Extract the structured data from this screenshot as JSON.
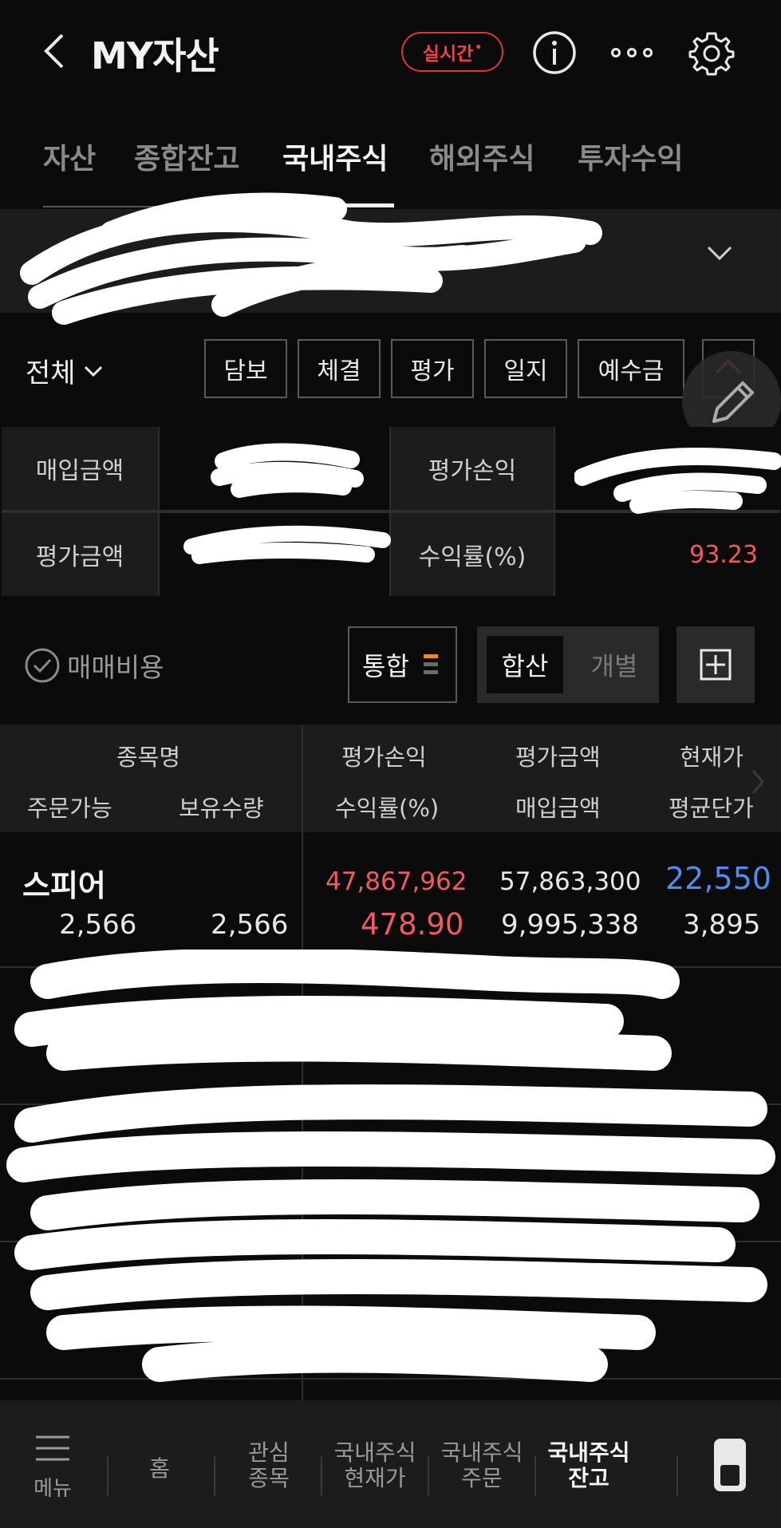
{
  "header": {
    "title": "MY자산",
    "realtime_label": "실시간",
    "realtime_dot": "•"
  },
  "tabs": [
    {
      "label": "자산",
      "active": false
    },
    {
      "label": "종합잔고",
      "active": false
    },
    {
      "label": "국내주식",
      "active": true
    },
    {
      "label": "해외주식",
      "active": false
    },
    {
      "label": "투자수익",
      "active": false
    }
  ],
  "filter": {
    "all_label": "전체",
    "buttons": [
      "담보",
      "체결",
      "평가",
      "일지",
      "예수금"
    ]
  },
  "summary": {
    "purchase_label": "매입금액",
    "eval_pnl_label": "평가손익",
    "eval_amount_label": "평가금액",
    "return_label": "수익률(%)",
    "return_value": "93.23"
  },
  "options": {
    "fee_label": "매매비용",
    "tonghap_label": "통합",
    "seg_on": "합산",
    "seg_off": "개별"
  },
  "table": {
    "headers_top": [
      "종목명",
      "평가손익",
      "평가금액",
      "현재가"
    ],
    "headers_bottom": [
      "주문가능",
      "보유수량",
      "수익률(%)",
      "매입금액",
      "평균단가"
    ],
    "rows": [
      {
        "name": "스피어",
        "order_avail": "2,566",
        "holding_qty": "2,566",
        "eval_pnl": "47,867,962",
        "return_rate": "478.90",
        "eval_amount": "57,863,300",
        "purchase_amount": "9,995,338",
        "current_price": "22,550",
        "avg_price": "3,895"
      }
    ]
  },
  "bottom_nav": {
    "menu_label": "메뉴",
    "items": [
      {
        "label": "홈",
        "active": false
      },
      {
        "label": "관심\n종목",
        "active": false
      },
      {
        "label": "국내주식\n현재가",
        "active": false
      },
      {
        "label": "국내주식\n주문",
        "active": false
      },
      {
        "label": "국내주식\n잔고",
        "active": true
      }
    ]
  },
  "colors": {
    "background": "#0b0b0b",
    "panel": "#1c1c1c",
    "positive_red": "#ef5b5f",
    "price_blue": "#4d8ef0",
    "realtime_red": "#e0353b"
  }
}
